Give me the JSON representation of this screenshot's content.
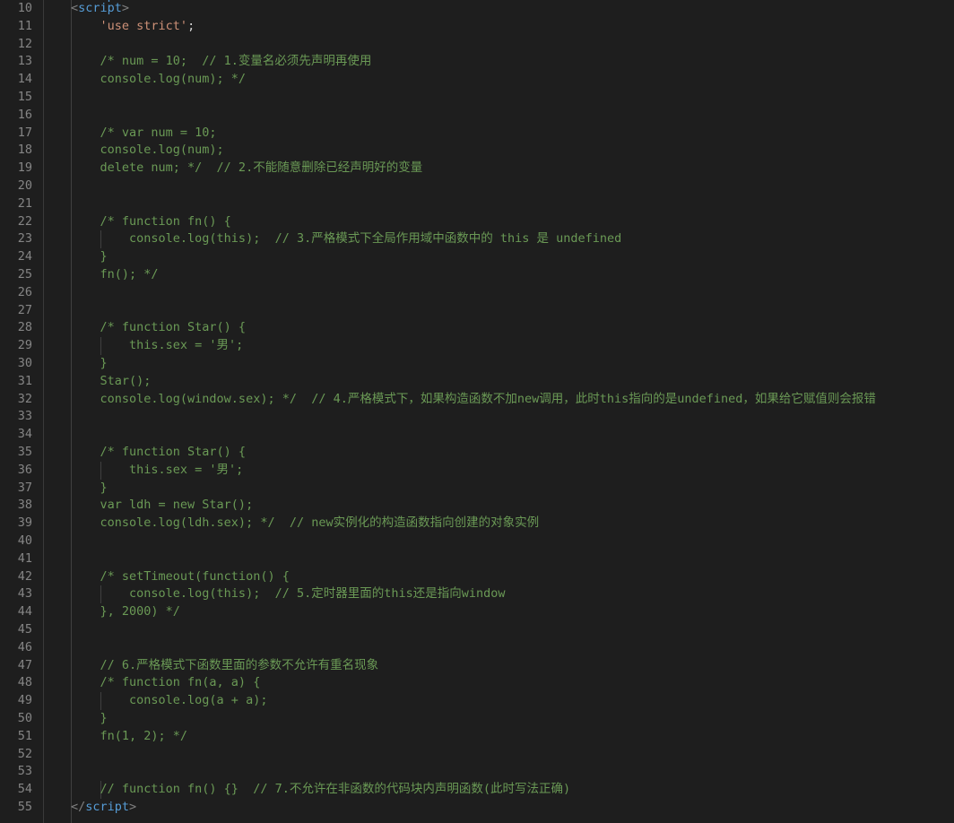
{
  "editor": {
    "name": "vscode-code-editor",
    "theme": "dark-plus",
    "background_color": "#1e1e1e",
    "gutter_color": "#858585",
    "comment_color": "#6a9955",
    "tag_color": "#569cd6",
    "string_color": "#ce9178",
    "text_color": "#d4d4d4",
    "indent_guide_color": "#404040",
    "first_visible_line": 10,
    "last_visible_line": 55,
    "language": "html",
    "partial_top_line": "<script>"
  },
  "lines": [
    {
      "n": "10",
      "indent": 0,
      "guide": false,
      "spans": [
        {
          "t": "<",
          "c": "punct"
        },
        {
          "t": "script",
          "c": "tag"
        },
        {
          "t": ">",
          "c": "punct"
        }
      ]
    },
    {
      "n": "11",
      "indent": 4,
      "guide": false,
      "spans": [
        {
          "t": "    ",
          "c": "plain"
        },
        {
          "t": "'use strict'",
          "c": "string"
        },
        {
          "t": ";",
          "c": "plain"
        }
      ]
    },
    {
      "n": "12",
      "indent": 0,
      "guide": false,
      "spans": []
    },
    {
      "n": "13",
      "indent": 4,
      "guide": false,
      "spans": [
        {
          "t": "    /* num = 10;  // 1.变量名必须先声明再使用",
          "c": "comment"
        }
      ]
    },
    {
      "n": "14",
      "indent": 4,
      "guide": false,
      "spans": [
        {
          "t": "    console.log(num); */",
          "c": "comment"
        }
      ]
    },
    {
      "n": "15",
      "indent": 0,
      "guide": false,
      "spans": []
    },
    {
      "n": "16",
      "indent": 0,
      "guide": false,
      "spans": []
    },
    {
      "n": "17",
      "indent": 4,
      "guide": false,
      "spans": [
        {
          "t": "    /* var num = 10;",
          "c": "comment"
        }
      ]
    },
    {
      "n": "18",
      "indent": 4,
      "guide": false,
      "spans": [
        {
          "t": "    console.log(num);",
          "c": "comment"
        }
      ]
    },
    {
      "n": "19",
      "indent": 4,
      "guide": false,
      "spans": [
        {
          "t": "    delete num; */  // 2.不能随意删除已经声明好的变量",
          "c": "comment"
        }
      ]
    },
    {
      "n": "20",
      "indent": 0,
      "guide": false,
      "spans": []
    },
    {
      "n": "21",
      "indent": 0,
      "guide": false,
      "spans": []
    },
    {
      "n": "22",
      "indent": 4,
      "guide": false,
      "spans": [
        {
          "t": "    /* function fn() {",
          "c": "comment"
        }
      ]
    },
    {
      "n": "23",
      "indent": 8,
      "guide": true,
      "spans": [
        {
          "t": "        console.log(this);  // 3.严格模式下全局作用域中函数中的 this 是 undefined",
          "c": "comment"
        }
      ]
    },
    {
      "n": "24",
      "indent": 4,
      "guide": false,
      "spans": [
        {
          "t": "    }",
          "c": "comment"
        }
      ]
    },
    {
      "n": "25",
      "indent": 4,
      "guide": false,
      "spans": [
        {
          "t": "    fn(); */",
          "c": "comment"
        }
      ]
    },
    {
      "n": "26",
      "indent": 0,
      "guide": false,
      "spans": []
    },
    {
      "n": "27",
      "indent": 0,
      "guide": false,
      "spans": []
    },
    {
      "n": "28",
      "indent": 4,
      "guide": false,
      "spans": [
        {
          "t": "    /* function Star() {",
          "c": "comment"
        }
      ]
    },
    {
      "n": "29",
      "indent": 8,
      "guide": true,
      "spans": [
        {
          "t": "        this.sex = '男';",
          "c": "comment"
        }
      ]
    },
    {
      "n": "30",
      "indent": 4,
      "guide": false,
      "spans": [
        {
          "t": "    }",
          "c": "comment"
        }
      ]
    },
    {
      "n": "31",
      "indent": 4,
      "guide": false,
      "spans": [
        {
          "t": "    Star();",
          "c": "comment"
        }
      ]
    },
    {
      "n": "32",
      "indent": 4,
      "guide": false,
      "spans": [
        {
          "t": "    console.log(window.sex); */  // 4.严格模式下，如果构造函数不加new调用，此时this指向的是undefined，如果给它赋值则会报错",
          "c": "comment"
        }
      ]
    },
    {
      "n": "33",
      "indent": 0,
      "guide": false,
      "spans": []
    },
    {
      "n": "34",
      "indent": 0,
      "guide": false,
      "spans": []
    },
    {
      "n": "35",
      "indent": 4,
      "guide": false,
      "spans": [
        {
          "t": "    /* function Star() {",
          "c": "comment"
        }
      ]
    },
    {
      "n": "36",
      "indent": 8,
      "guide": true,
      "spans": [
        {
          "t": "        this.sex = '男';",
          "c": "comment"
        }
      ]
    },
    {
      "n": "37",
      "indent": 4,
      "guide": false,
      "spans": [
        {
          "t": "    }",
          "c": "comment"
        }
      ]
    },
    {
      "n": "38",
      "indent": 4,
      "guide": false,
      "spans": [
        {
          "t": "    var ldh = new Star();",
          "c": "comment"
        }
      ]
    },
    {
      "n": "39",
      "indent": 4,
      "guide": false,
      "spans": [
        {
          "t": "    console.log(ldh.sex); */  // new实例化的构造函数指向创建的对象实例",
          "c": "comment"
        }
      ]
    },
    {
      "n": "40",
      "indent": 0,
      "guide": false,
      "spans": []
    },
    {
      "n": "41",
      "indent": 0,
      "guide": false,
      "spans": []
    },
    {
      "n": "42",
      "indent": 4,
      "guide": false,
      "spans": [
        {
          "t": "    /* setTimeout(function() {",
          "c": "comment"
        }
      ]
    },
    {
      "n": "43",
      "indent": 8,
      "guide": true,
      "spans": [
        {
          "t": "        console.log(this);  // 5.定时器里面的this还是指向window",
          "c": "comment"
        }
      ]
    },
    {
      "n": "44",
      "indent": 4,
      "guide": false,
      "spans": [
        {
          "t": "    }, 2000) */",
          "c": "comment"
        }
      ]
    },
    {
      "n": "45",
      "indent": 0,
      "guide": false,
      "spans": []
    },
    {
      "n": "46",
      "indent": 0,
      "guide": false,
      "spans": []
    },
    {
      "n": "47",
      "indent": 4,
      "guide": false,
      "spans": [
        {
          "t": "    // 6.严格模式下函数里面的参数不允许有重名现象",
          "c": "comment"
        }
      ]
    },
    {
      "n": "48",
      "indent": 4,
      "guide": false,
      "spans": [
        {
          "t": "    /* function fn(a, a) {",
          "c": "comment"
        }
      ]
    },
    {
      "n": "49",
      "indent": 8,
      "guide": true,
      "spans": [
        {
          "t": "        console.log(a + a);",
          "c": "comment"
        }
      ]
    },
    {
      "n": "50",
      "indent": 4,
      "guide": false,
      "spans": [
        {
          "t": "    }",
          "c": "comment"
        }
      ]
    },
    {
      "n": "51",
      "indent": 4,
      "guide": false,
      "spans": [
        {
          "t": "    fn(1, 2); */",
          "c": "comment"
        }
      ]
    },
    {
      "n": "52",
      "indent": 0,
      "guide": false,
      "spans": []
    },
    {
      "n": "53",
      "indent": 0,
      "guide": false,
      "spans": []
    },
    {
      "n": "54",
      "indent": 4,
      "guide": true,
      "spans": [
        {
          "t": "    // function fn() {}  // 7.不允许在非函数的代码块内声明函数(此时写法正确)",
          "c": "comment"
        }
      ]
    },
    {
      "n": "55",
      "indent": 0,
      "guide": false,
      "spans": [
        {
          "t": "</",
          "c": "punct"
        },
        {
          "t": "script",
          "c": "tag"
        },
        {
          "t": ">",
          "c": "punct"
        }
      ]
    }
  ]
}
